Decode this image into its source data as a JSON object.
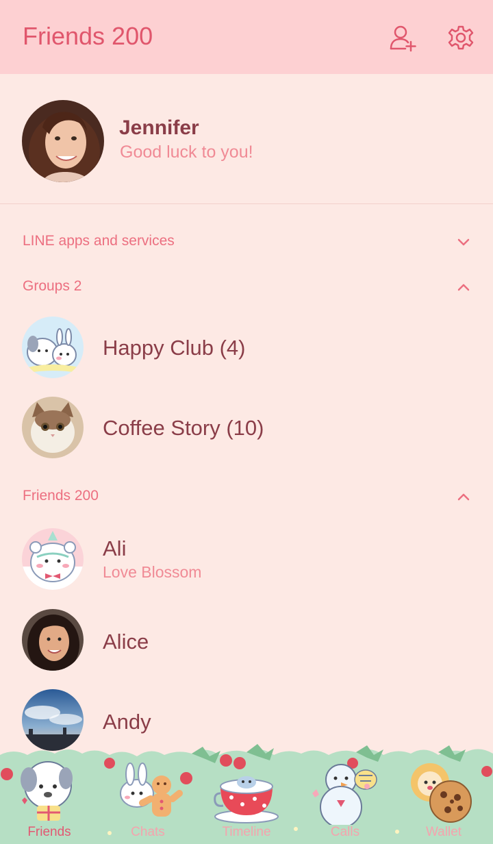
{
  "header": {
    "title": "Friends 200",
    "add_icon": "add-friend-icon",
    "settings_icon": "gear-icon"
  },
  "profile": {
    "name": "Jennifer",
    "status": "Good luck to you!"
  },
  "sections": {
    "line_apps": {
      "label": "LINE apps and services",
      "expanded": false
    },
    "groups": {
      "label": "Groups 2",
      "expanded": true
    },
    "friends": {
      "label": "Friends 200",
      "expanded": true
    }
  },
  "groups": [
    {
      "name": "Happy Club (4)"
    },
    {
      "name": "Coffee Story (10)"
    }
  ],
  "friends": [
    {
      "name": "Ali",
      "status": "Love Blossom"
    },
    {
      "name": "Alice",
      "status": ""
    },
    {
      "name": "Andy",
      "status": ""
    }
  ],
  "tabs": [
    {
      "label": "Friends",
      "active": true
    },
    {
      "label": "Chats",
      "active": false
    },
    {
      "label": "Timeline",
      "active": false
    },
    {
      "label": "Calls",
      "active": false
    },
    {
      "label": "Wallet",
      "active": false
    }
  ],
  "colors": {
    "header_bg": "#fdd0d2",
    "body_bg": "#fde9e4",
    "accent": "#e0566c",
    "name_text": "#8a3d48",
    "status_text": "#f08a95"
  }
}
